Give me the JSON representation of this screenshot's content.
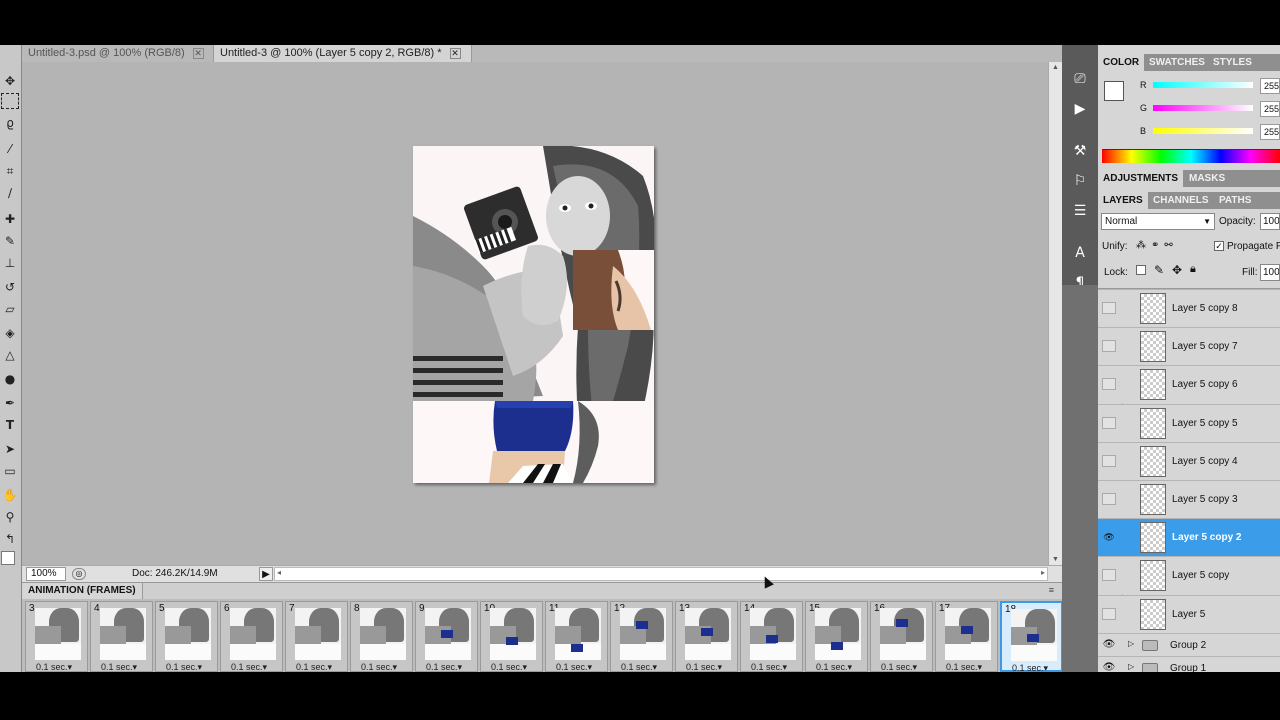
{
  "tabs": [
    {
      "label": "Untitled-3.psd @ 100% (RGB/8)",
      "active": false
    },
    {
      "label": "Untitled-3 @ 100% (Layer 5 copy 2, RGB/8) *",
      "active": true
    }
  ],
  "status": {
    "zoom": "100%",
    "doc": "Doc: 246.2K/14.9M"
  },
  "animation": {
    "title": "ANIMATION (FRAMES)",
    "frames": [
      {
        "num": "3",
        "delay": "0.1 sec.▾"
      },
      {
        "num": "4",
        "delay": "0.1 sec.▾"
      },
      {
        "num": "5",
        "delay": "0.1 sec.▾"
      },
      {
        "num": "6",
        "delay": "0.1 sec.▾"
      },
      {
        "num": "7",
        "delay": "0.1 sec.▾"
      },
      {
        "num": "8",
        "delay": "0.1 sec.▾"
      },
      {
        "num": "9",
        "delay": "0.1 sec.▾"
      },
      {
        "num": "10",
        "delay": "0.1 sec.▾"
      },
      {
        "num": "11",
        "delay": "0.1 sec.▾"
      },
      {
        "num": "12",
        "delay": "0.1 sec.▾"
      },
      {
        "num": "13",
        "delay": "0.1 sec.▾"
      },
      {
        "num": "14",
        "delay": "0.1 sec.▾"
      },
      {
        "num": "15",
        "delay": "0.1 sec.▾"
      },
      {
        "num": "16",
        "delay": "0.1 sec.▾"
      },
      {
        "num": "17",
        "delay": "0.1 sec.▾"
      },
      {
        "num": "18",
        "delay": "0.1 sec.▾"
      }
    ]
  },
  "color_panel": {
    "tabs": [
      "COLOR",
      "SWATCHES",
      "STYLES"
    ],
    "channels": [
      {
        "label": "R",
        "value": "255"
      },
      {
        "label": "G",
        "value": "255"
      },
      {
        "label": "B",
        "value": "255"
      }
    ]
  },
  "adjust_tabs": [
    "ADJUSTMENTS",
    "MASKS"
  ],
  "layers_panel": {
    "tabs": [
      "LAYERS",
      "CHANNELS",
      "PATHS"
    ],
    "blend_mode": "Normal",
    "opacity_label": "Opacity:",
    "opacity_value": "100",
    "unify_label": "Unify:",
    "propagate_label": "Propagate F",
    "lock_label": "Lock:",
    "fill_label": "Fill:",
    "fill_value": "100",
    "layers": [
      {
        "name": "Layer 5 copy 8",
        "selected": false
      },
      {
        "name": "Layer 5 copy 7",
        "selected": false
      },
      {
        "name": "Layer 5 copy 6",
        "selected": false
      },
      {
        "name": "Layer 5 copy 5",
        "selected": false
      },
      {
        "name": "Layer 5 copy 4",
        "selected": false
      },
      {
        "name": "Layer 5 copy 3",
        "selected": false
      },
      {
        "name": "Layer 5 copy 2",
        "selected": true
      },
      {
        "name": "Layer 5 copy",
        "selected": false
      },
      {
        "name": "Layer 5",
        "selected": false
      }
    ],
    "groups": [
      {
        "name": "Group 2"
      },
      {
        "name": "Group 1"
      }
    ]
  }
}
